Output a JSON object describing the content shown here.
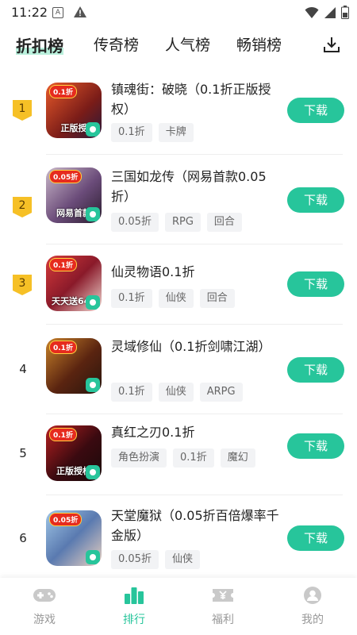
{
  "status_bar": {
    "time": "11:22",
    "a_icon_letter": "A"
  },
  "tabs": [
    {
      "label": "折扣榜",
      "active": true
    },
    {
      "label": "传奇榜",
      "active": false
    },
    {
      "label": "人气榜",
      "active": false
    },
    {
      "label": "畅销榜",
      "active": false
    }
  ],
  "colors": {
    "accent": "#27c59b",
    "badge": "#f6c026",
    "tab_highlight": "#b9f0dc"
  },
  "games": [
    {
      "rank": "1",
      "title": "镇魂街：破晓（0.1折正版授权）",
      "icon_badge": "0.1折",
      "icon_caption": "正版授",
      "tags": [
        "0.1折",
        "卡牌"
      ],
      "download": "下载"
    },
    {
      "rank": "2",
      "title": "三国如龙传（网易首款0.05折）",
      "icon_badge": "0.05折",
      "icon_caption": "网易首款",
      "tags": [
        "0.05折",
        "RPG",
        "回合"
      ],
      "download": "下载"
    },
    {
      "rank": "3",
      "title": "仙灵物语0.1折",
      "icon_badge": "0.1折",
      "icon_caption": "天天送648",
      "tags": [
        "0.1折",
        "仙侠",
        "回合"
      ],
      "download": "下载"
    },
    {
      "rank": "4",
      "title": "灵域修仙（0.1折剑啸江湖）",
      "icon_badge": "0.1折",
      "icon_caption": "",
      "tags": [
        "0.1折",
        "仙侠",
        "ARPG"
      ],
      "download": "下载"
    },
    {
      "rank": "5",
      "title": "真红之刃0.1折",
      "icon_badge": "0.1折",
      "icon_caption": "正版授权",
      "tags": [
        "角色扮演",
        "0.1折",
        "魔幻"
      ],
      "download": "下载"
    },
    {
      "rank": "6",
      "title": "天堂魔狱（0.05折百倍爆率千金版）",
      "icon_badge": "0.05折",
      "icon_caption": "",
      "tags": [
        "0.05折",
        "仙侠"
      ],
      "download": "下载"
    }
  ],
  "bottom_nav": [
    {
      "label": "游戏",
      "icon": "gamepad-icon",
      "active": false
    },
    {
      "label": "排行",
      "icon": "ranking-icon",
      "active": true
    },
    {
      "label": "福利",
      "icon": "ticket-icon",
      "active": false
    },
    {
      "label": "我的",
      "icon": "user-icon",
      "active": false
    }
  ]
}
